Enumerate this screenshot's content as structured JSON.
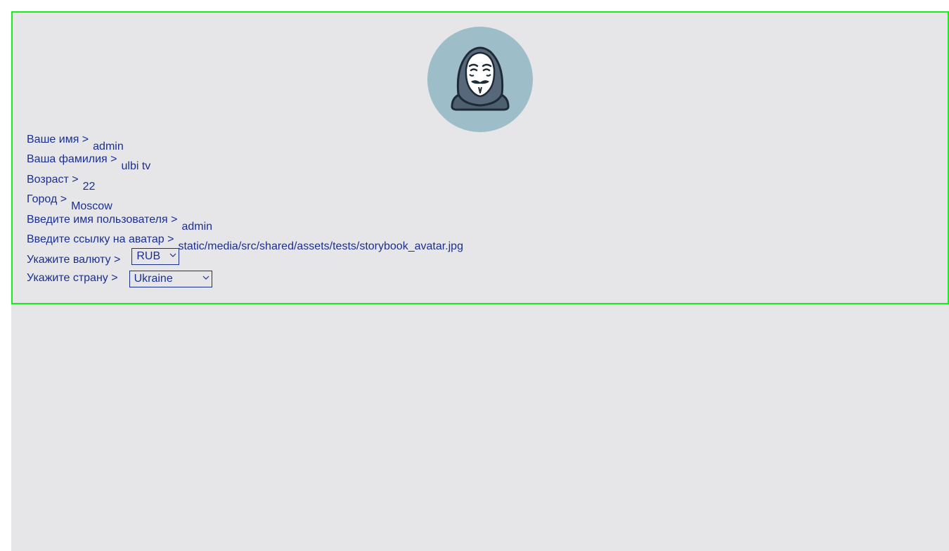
{
  "profile": {
    "fields": [
      {
        "label": "Ваше имя >",
        "value": "admin"
      },
      {
        "label": "Ваша фамилия >",
        "value": "ulbi tv"
      },
      {
        "label": "Возраст >",
        "value": "22"
      },
      {
        "label": "Город >",
        "value": "Moscow"
      },
      {
        "label": "Введите имя пользователя >",
        "value": "admin"
      },
      {
        "label": "Введите ссылку на аватар >",
        "value": "static/media/src/shared/assets/tests/storybook_avatar.jpg"
      }
    ],
    "currency": {
      "label": "Укажите валюту >",
      "selected": "RUB"
    },
    "country": {
      "label": "Укажите страну >",
      "selected": "Ukraine"
    }
  },
  "avatar": {
    "icon": "anonymous-mask-avatar"
  },
  "colors": {
    "text": "#1b2f8f",
    "card_border": "#1aee1a",
    "background": "#e6e6e9",
    "avatar_bg": "#9dbdc8"
  }
}
